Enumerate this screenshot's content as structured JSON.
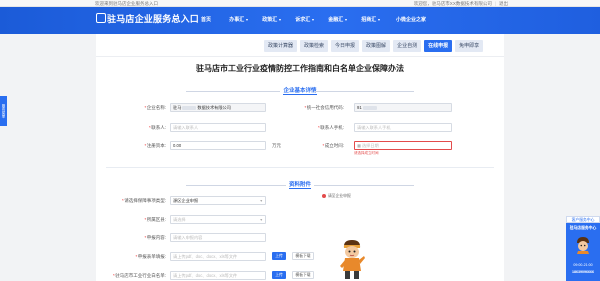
{
  "topbar": {
    "welcome": "欢迎来到驻马店企业服务总入口",
    "greeting": "欢迎您，",
    "user": "驻马店市XX数据技术有限公司",
    "logout": "退出"
  },
  "header": {
    "logo_text": "驻马店企业服务总入口",
    "nav": [
      {
        "label": "首页",
        "has_menu": false
      },
      {
        "label": "办事汇",
        "has_menu": true
      },
      {
        "label": "政策汇",
        "has_menu": true
      },
      {
        "label": "诉求汇",
        "has_menu": true
      },
      {
        "label": "金融汇",
        "has_menu": true
      },
      {
        "label": "招商汇",
        "has_menu": true
      },
      {
        "label": "小微企业之家",
        "has_menu": false
      }
    ],
    "side_tab": "服务菜单"
  },
  "tabs": [
    {
      "label": "政策计算器",
      "active": false
    },
    {
      "label": "政策检索",
      "active": false
    },
    {
      "label": "今日申报",
      "active": false
    },
    {
      "label": "政策图解",
      "active": false
    },
    {
      "label": "企业自测",
      "active": false
    },
    {
      "label": "在线申报",
      "active": true
    },
    {
      "label": "免申即享",
      "active": false
    }
  ],
  "page_title": "驻马店市工业行业疫情防控工作指南和白名单企业保障办法",
  "basic_info": {
    "section_title": "企业基本详情",
    "company_name_label": "企业名称:",
    "company_name_prefix": "驻马",
    "company_name_suffix": "数据技术有限公司",
    "credit_code_label": "统一社会信用代码:",
    "credit_code_value": "91",
    "contact_label": "联系人:",
    "contact_placeholder": "请输入联系人",
    "contact_phone_label": "联系人手机:",
    "contact_phone_placeholder": "请输入联系人手机",
    "capital_label": "注册资本:",
    "capital_value": "0.00",
    "capital_unit": "万元",
    "found_date_label": "成立时间:",
    "found_date_placeholder": "选择日期",
    "found_date_error": "请选择成立时间"
  },
  "materials": {
    "section_title": "资料附件",
    "guarantee_type_label": "请选择保障事项类型:",
    "guarantee_type_value": "源区企业申报",
    "required_note": "请至企业申报",
    "region_label": "所属区县:",
    "region_placeholder": "请选择",
    "declare_label": "申报内容:",
    "declare_placeholder": "请输入申报内容",
    "form_label": "申报表单填报:",
    "form_placeholder": "请上传pdf、doc、docx、xls等文件",
    "upload_label": "上传",
    "download_label": "模板下载",
    "whitelist_label": "驻马店市工业行业白名单:",
    "whitelist_placeholder": "请上传pdf、doc、docx、xls等文件"
  },
  "side_widget": {
    "header": "客户服务中心",
    "brand": "驻马店服务中心",
    "hours": "09:00-21:00",
    "phone": "18639096666"
  },
  "colors": {
    "primary": "#2a6ef0",
    "error": "#e34b4b",
    "page_bg": "#f2f3f5"
  }
}
